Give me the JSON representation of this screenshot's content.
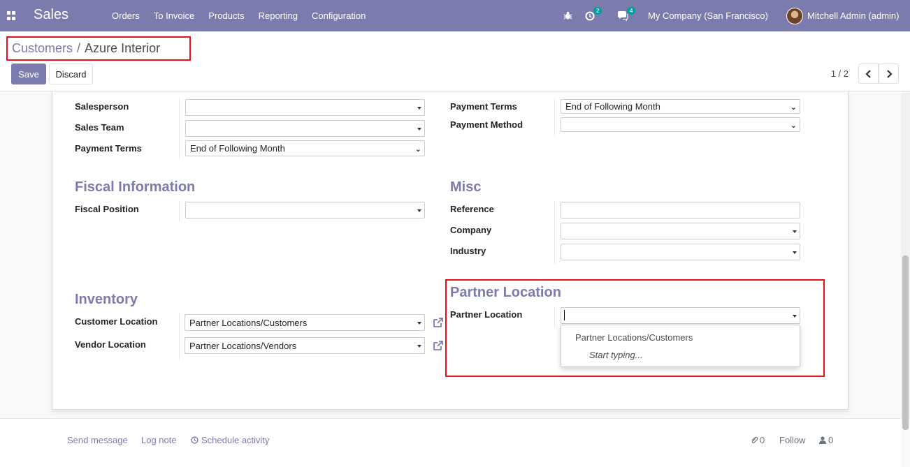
{
  "navbar": {
    "app_name": "Sales",
    "menu": [
      "Orders",
      "To Invoice",
      "Products",
      "Reporting",
      "Configuration"
    ],
    "activity_count": "2",
    "message_count": "4",
    "company": "My Company (San Francisco)",
    "user": "Mitchell Admin (admin)",
    "color": "#7c7bad"
  },
  "control": {
    "breadcrumb_parent": "Customers",
    "breadcrumb_separator": "/",
    "breadcrumb_current": "Azure Interior",
    "save_label": "Save",
    "discard_label": "Discard",
    "pager": "1 / 2"
  },
  "form": {
    "sales": {
      "salesperson_label": "Salesperson",
      "salesperson_value": "",
      "sales_team_label": "Sales Team",
      "sales_team_value": "",
      "payment_terms_label": "Payment Terms",
      "payment_terms_value": "End of Following Month"
    },
    "purchase": {
      "payment_terms_label": "Payment Terms",
      "payment_terms_value": "End of Following Month",
      "payment_method_label": "Payment Method",
      "payment_method_value": ""
    },
    "fiscal": {
      "title": "Fiscal Information",
      "fiscal_position_label": "Fiscal Position",
      "fiscal_position_value": ""
    },
    "misc": {
      "title": "Misc",
      "reference_label": "Reference",
      "reference_value": "",
      "company_label": "Company",
      "company_value": "",
      "industry_label": "Industry",
      "industry_value": ""
    },
    "inventory": {
      "title": "Inventory",
      "customer_location_label": "Customer Location",
      "customer_location_value": "Partner Locations/Customers",
      "vendor_location_label": "Vendor Location",
      "vendor_location_value": "Partner Locations/Vendors"
    },
    "partner_location": {
      "title": "Partner Location",
      "label": "Partner Location",
      "value": "",
      "dropdown_option": "Partner Locations/Customers",
      "dropdown_hint": "Start typing..."
    }
  },
  "chatter": {
    "send_message": "Send message",
    "log_note": "Log note",
    "schedule_activity": "Schedule activity",
    "attachments": "0",
    "follow": "Follow",
    "followers": "0"
  }
}
